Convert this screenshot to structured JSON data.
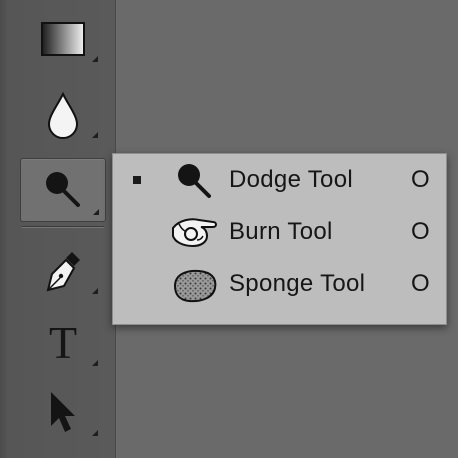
{
  "toolbar": {
    "tools": [
      {
        "name": "gradient-tool",
        "icon": "gradient-icon"
      },
      {
        "name": "blur-tool",
        "icon": "blur-drop-icon"
      },
      {
        "name": "dodge-tool",
        "icon": "dodge-icon",
        "active": true
      },
      {
        "name": "pen-tool",
        "icon": "pen-nib-icon"
      },
      {
        "name": "type-tool",
        "icon": "type-icon",
        "glyph": "T"
      },
      {
        "name": "path-selection-tool",
        "icon": "arrow-icon"
      }
    ]
  },
  "flyout": {
    "items": [
      {
        "label": "Dodge Tool",
        "shortcut": "O",
        "selected": true,
        "icon": "dodge-icon"
      },
      {
        "label": "Burn Tool",
        "shortcut": "O",
        "selected": false,
        "icon": "burn-hand-icon"
      },
      {
        "label": "Sponge Tool",
        "shortcut": "O",
        "selected": false,
        "icon": "sponge-icon"
      }
    ]
  },
  "colors": {
    "toolbar_bg": "#5a5a5a",
    "flyout_bg": "#bdbdbd",
    "active_tool_bg": "#717171"
  }
}
